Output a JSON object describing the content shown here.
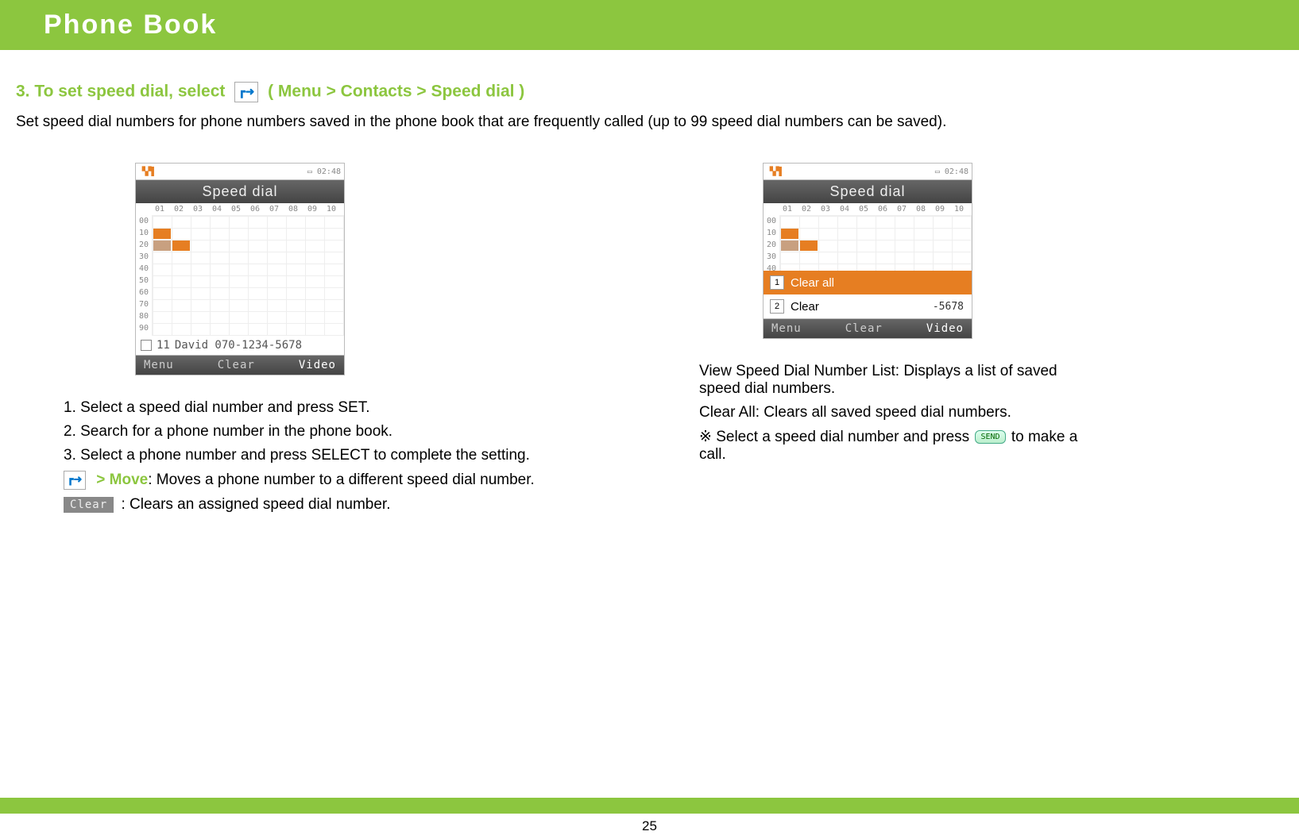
{
  "header": {
    "title": "Phone Book"
  },
  "section": {
    "num_label": "3. To set speed dial, select",
    "breadcrumb": "( Menu > Contacts > Speed dial )"
  },
  "intro": "Set speed dial numbers for phone numbers saved in the phone book that are frequently called (up to 99 speed dial numbers can be saved).",
  "phone_common": {
    "time": "02:48",
    "screen_title": "Speed dial",
    "cols": [
      "01",
      "02",
      "03",
      "04",
      "05",
      "06",
      "07",
      "08",
      "09",
      "10"
    ],
    "rows_full": [
      "00",
      "10",
      "20",
      "30",
      "40",
      "50",
      "60",
      "70",
      "80",
      "90"
    ],
    "rows_short": [
      "00",
      "10",
      "20",
      "30",
      "40",
      "50",
      "60",
      "70"
    ],
    "softkey_left": "Menu",
    "softkey_mid": "Clear",
    "softkey_right": "Video"
  },
  "shot1": {
    "filled": [
      {
        "row": 1,
        "col": 0,
        "dim": false
      },
      {
        "row": 2,
        "col": 0,
        "dim": true
      },
      {
        "row": 2,
        "col": 1,
        "dim": false
      }
    ],
    "entry_num": "11",
    "entry_text": "David 070-1234-5678"
  },
  "shot2": {
    "filled": [
      {
        "row": 1,
        "col": 0,
        "dim": false
      },
      {
        "row": 2,
        "col": 0,
        "dim": true
      },
      {
        "row": 2,
        "col": 1,
        "dim": false
      }
    ],
    "popup": {
      "item1": {
        "n": "1",
        "label": "Clear all"
      },
      "item2": {
        "n": "2",
        "label": "Clear",
        "frag": "-5678"
      }
    }
  },
  "left_steps": {
    "s1": "1. Select a speed dial number and press SET.",
    "s2": "2. Search for a phone number in the phone book.",
    "s3": "3. Select a phone number and press SELECT to complete the setting.",
    "move_label": "> Move",
    "move_rest": ": Moves a phone number to a different speed dial number.",
    "clear_rest": ": Clears an assigned speed dial number.",
    "clear_chip": "Clear"
  },
  "right_steps": {
    "p1": "View Speed Dial Number List: Displays a list of saved speed dial numbers.",
    "p2": "Clear All: Clears all saved speed dial numbers.",
    "p3a": "※ Select a speed dial number and press",
    "send_chip": "SEND",
    "p3b": "to make a call."
  },
  "page_number": "25"
}
